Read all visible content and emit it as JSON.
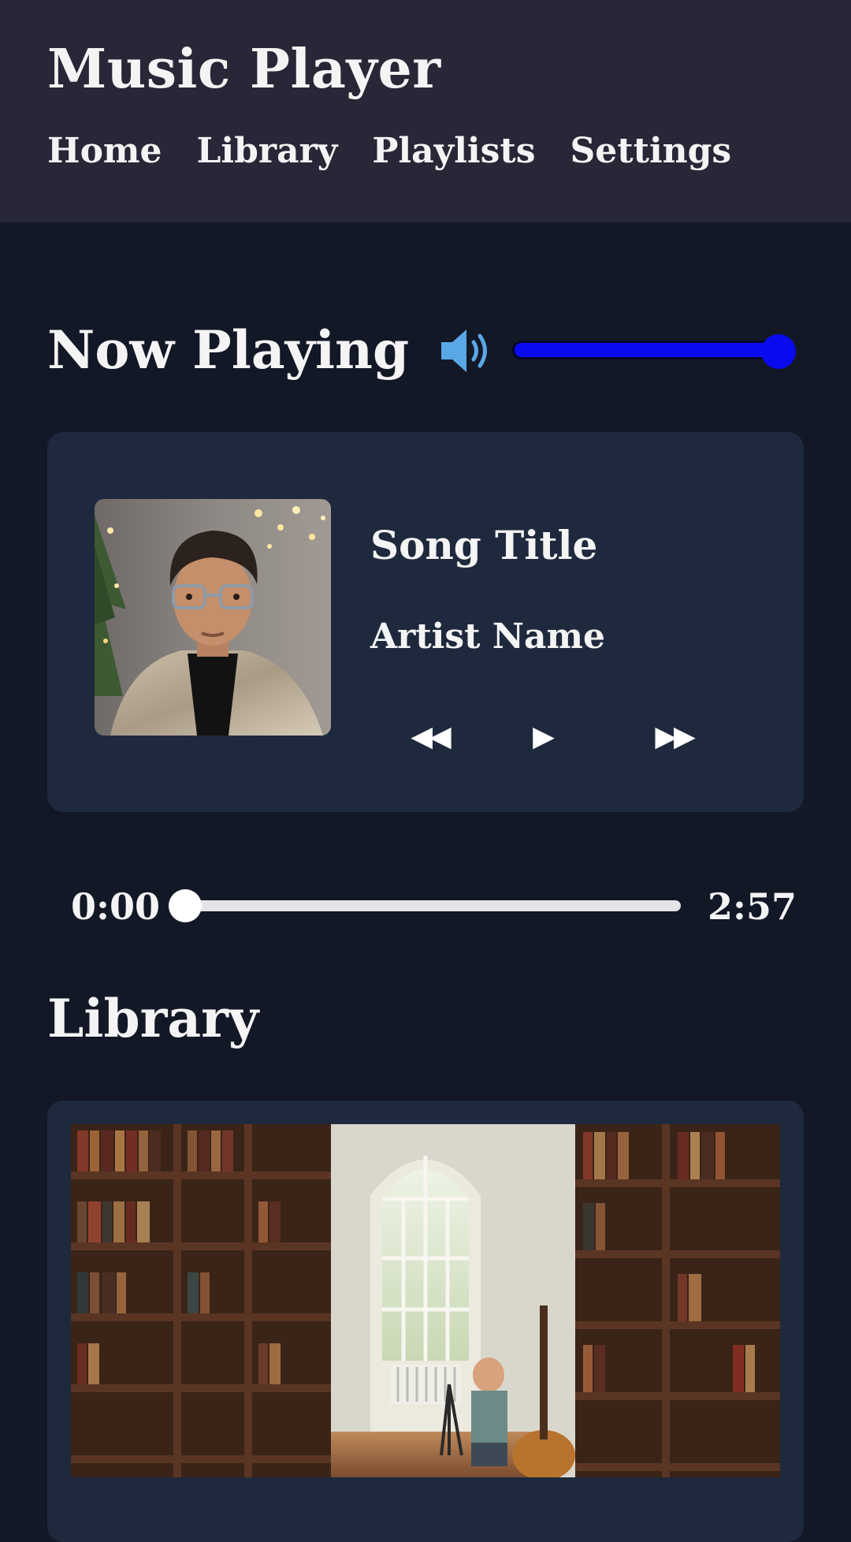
{
  "header": {
    "title": "Music Player",
    "nav": [
      {
        "label": "Home"
      },
      {
        "label": "Library"
      },
      {
        "label": "Playlists"
      },
      {
        "label": "Settings"
      }
    ]
  },
  "now_playing": {
    "heading": "Now Playing",
    "volume": {
      "icon": "speaker-icon",
      "level": 1.0,
      "color": "#0a0af0"
    },
    "song": {
      "title": "Song Title",
      "artist": "Artist Name",
      "album_art": "portrait-photo"
    },
    "controls": {
      "prev_label": "◀◀",
      "play_label": "▶",
      "next_label": "▶▶"
    },
    "progress": {
      "current": "0:00",
      "total": "2:57",
      "fraction": 0.0
    }
  },
  "library": {
    "heading": "Library",
    "image": "library-room-photo"
  },
  "colors": {
    "header_bg": "#282737",
    "page_bg": "#131827",
    "card_bg": "#1f293d",
    "accent_volume": "#0a0af0",
    "volume_icon": "#5aa7e6"
  }
}
